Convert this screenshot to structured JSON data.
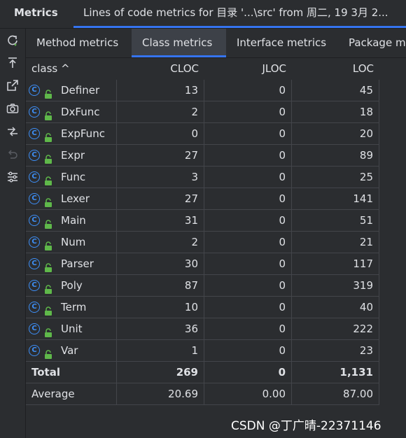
{
  "window": {
    "tool_window_title": "Metrics",
    "content_tab_title": "Lines of code metrics for 目录 '...\\src' from 周二, 19 3月 2..."
  },
  "toolbar": {
    "icons": [
      "rerun-icon",
      "export-icon",
      "open-in-editor-icon",
      "snapshot-icon",
      "compare-icon",
      "undo-icon",
      "settings-icon"
    ]
  },
  "tabs": [
    {
      "label": "Method metrics",
      "active": false
    },
    {
      "label": "Class metrics",
      "active": true
    },
    {
      "label": "Interface metrics",
      "active": false
    },
    {
      "label": "Package m",
      "active": false
    }
  ],
  "table": {
    "columns": [
      "class ^",
      "CLOC",
      "JLOC",
      "LOC"
    ],
    "rows": [
      {
        "name": "Definer",
        "cloc": "13",
        "jloc": "0",
        "loc": "45"
      },
      {
        "name": "DxFunc",
        "cloc": "2",
        "jloc": "0",
        "loc": "18"
      },
      {
        "name": "ExpFunc",
        "cloc": "0",
        "jloc": "0",
        "loc": "20"
      },
      {
        "name": "Expr",
        "cloc": "27",
        "jloc": "0",
        "loc": "89"
      },
      {
        "name": "Func",
        "cloc": "3",
        "jloc": "0",
        "loc": "25"
      },
      {
        "name": "Lexer",
        "cloc": "27",
        "jloc": "0",
        "loc": "141"
      },
      {
        "name": "Main",
        "cloc": "31",
        "jloc": "0",
        "loc": "51"
      },
      {
        "name": "Num",
        "cloc": "2",
        "jloc": "0",
        "loc": "21"
      },
      {
        "name": "Parser",
        "cloc": "30",
        "jloc": "0",
        "loc": "117"
      },
      {
        "name": "Poly",
        "cloc": "87",
        "jloc": "0",
        "loc": "319"
      },
      {
        "name": "Term",
        "cloc": "10",
        "jloc": "0",
        "loc": "40"
      },
      {
        "name": "Unit",
        "cloc": "36",
        "jloc": "0",
        "loc": "222"
      },
      {
        "name": "Var",
        "cloc": "1",
        "jloc": "0",
        "loc": "23"
      }
    ],
    "total": {
      "name": "Total",
      "cloc": "269",
      "jloc": "0",
      "loc": "1,131"
    },
    "average": {
      "name": "Average",
      "cloc": "20.69",
      "jloc": "0.00",
      "loc": "87.00"
    }
  },
  "watermark": "CSDN @丁广晴-22371146",
  "colors": {
    "accent": "#3574f0",
    "class_icon": "#3d8ef5",
    "lock_icon": "#5fb84a",
    "background": "#2b2d30"
  }
}
